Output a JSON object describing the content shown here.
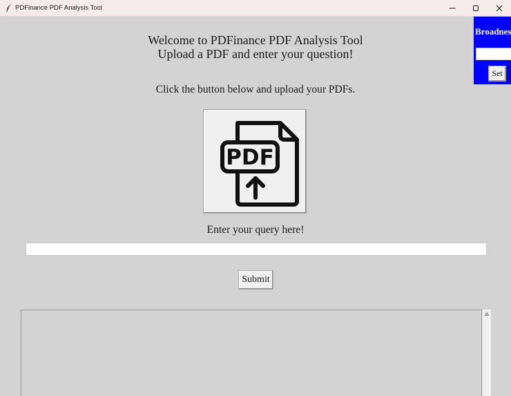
{
  "window": {
    "title": "PDFinance PDF Analysis Tool",
    "app_icon": "feather-icon",
    "controls": [
      "minimize-icon",
      "maximize-icon",
      "close-icon"
    ]
  },
  "main": {
    "welcome_line1": "Welcome to PDFinance PDF Analysis Tool",
    "welcome_line2": "Upload a PDF and enter your question!",
    "upload_instruction": "Click the button below and upload your PDFs.",
    "upload_icon": "pdf-upload-icon",
    "upload_icon_text": "PDF",
    "query_label": "Enter your query here!",
    "query_value": "",
    "submit_label": "Submit",
    "output_text": ""
  },
  "side_panel": {
    "label": "Broadness",
    "input_value": "",
    "set_label": "Set",
    "background": "#0000ff"
  },
  "colors": {
    "window_bg": "#d3d3d3",
    "titlebar_bg": "#f6ecec",
    "panel_accent": "#0000ff"
  }
}
